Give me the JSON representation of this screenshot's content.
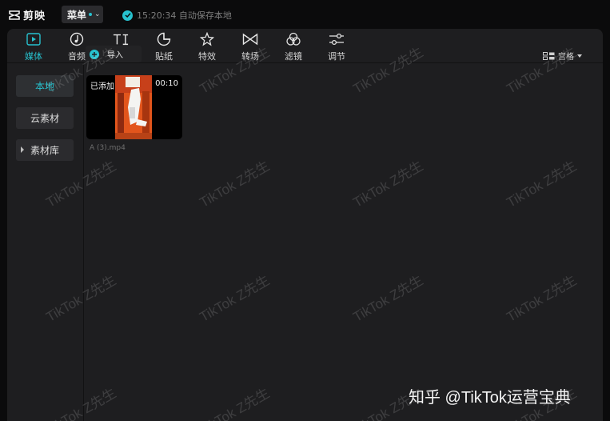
{
  "app": {
    "name": "剪映",
    "menu_label": "菜单",
    "save_status": "15:20:34 自动保存本地"
  },
  "colors": {
    "accent": "#27c2cf",
    "panel": "#1e1e20",
    "background": "#0b0b0c"
  },
  "toolbar": {
    "tabs": [
      {
        "label": "媒体",
        "icon": "media-play-icon",
        "active": true
      },
      {
        "label": "音频",
        "icon": "audio-note-icon",
        "active": false
      },
      {
        "label": "文本",
        "icon": "text-ti-icon",
        "active": false
      },
      {
        "label": "贴纸",
        "icon": "sticker-icon",
        "active": false
      },
      {
        "label": "特效",
        "icon": "effects-star-icon",
        "active": false
      },
      {
        "label": "转场",
        "icon": "transition-bowtie-icon",
        "active": false
      },
      {
        "label": "滤镜",
        "icon": "filter-circles-icon",
        "active": false
      },
      {
        "label": "调节",
        "icon": "adjust-sliders-icon",
        "active": false
      }
    ]
  },
  "sidebar": {
    "items": [
      {
        "label": "本地",
        "active": true
      },
      {
        "label": "云素材",
        "active": false
      },
      {
        "label": "素材库",
        "active": false,
        "expandable": true
      }
    ]
  },
  "content": {
    "import_label": "导入",
    "view_label": "宫格",
    "media": [
      {
        "status": "已添加",
        "duration": "00:10",
        "filename": "A (3).mp4"
      }
    ]
  },
  "watermark": {
    "text": "TikTok Z先生"
  },
  "footer_credit": "知乎 @TikTok运营宝典"
}
